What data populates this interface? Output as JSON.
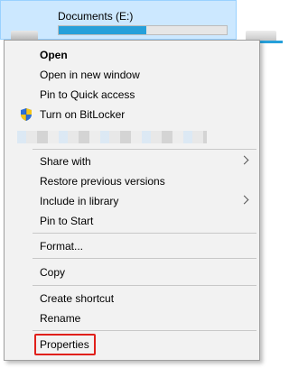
{
  "drive": {
    "name": "Documents (E:)",
    "usage_fraction": 0.52
  },
  "menu": {
    "open": "Open",
    "open_new_window": "Open in new window",
    "pin_quick_access": "Pin to Quick access",
    "turn_on_bitlocker": "Turn on BitLocker",
    "share_with": "Share with",
    "restore_previous": "Restore previous versions",
    "include_in_library": "Include in library",
    "pin_to_start": "Pin to Start",
    "format": "Format...",
    "copy": "Copy",
    "create_shortcut": "Create shortcut",
    "rename": "Rename",
    "properties": "Properties"
  },
  "colors": {
    "highlight": "#e0201b",
    "selection": "#cce8ff",
    "usage_bar": "#26a0da"
  },
  "icons": {
    "bitlocker": "shield-icon",
    "submenu": "chevron-right-icon"
  }
}
